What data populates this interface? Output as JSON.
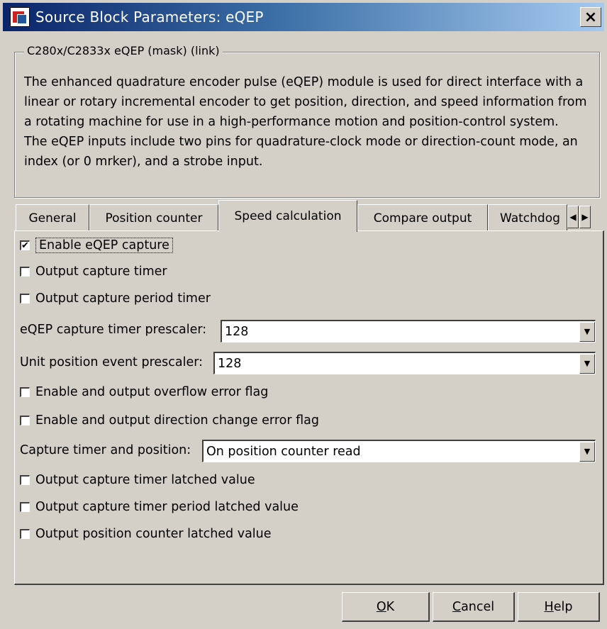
{
  "window": {
    "title": "Source Block Parameters: eQEP",
    "close_label": "×"
  },
  "group": {
    "legend": "C280x/C2833x eQEP (mask) (link)",
    "description": [
      "The enhanced quadrature encoder pulse (eQEP) module is used for direct interface with a linear or rotary incremental encoder to get position, direction, and speed information from a rotating machine for use in a high-performance motion and position-control system.",
      "The eQEP inputs include two pins for quadrature-clock mode or direction-count mode, an index (or 0 mrker), and a strobe input."
    ]
  },
  "tabs": [
    {
      "label": "General",
      "active": false
    },
    {
      "label": "Position counter",
      "active": false
    },
    {
      "label": "Speed calculation",
      "active": true
    },
    {
      "label": "Compare output",
      "active": false
    },
    {
      "label": "Watchdog",
      "active": false
    }
  ],
  "tab_scroll": {
    "left": "◀",
    "right": "▶"
  },
  "options": {
    "enable_capture": {
      "label": "Enable eQEP capture",
      "checked": true,
      "check_glyph": "✔"
    },
    "output_capture_timer": {
      "label": "Output capture timer",
      "checked": false
    },
    "output_capture_period_timer": {
      "label": "Output capture period timer",
      "checked": false
    },
    "capture_timer_prescaler": {
      "label": "eQEP capture timer prescaler:",
      "value": "128"
    },
    "unit_position_prescaler": {
      "label": "Unit position event prescaler:",
      "value": "128"
    },
    "overflow_error_flag": {
      "label": "Enable and output overflow error flag",
      "checked": false
    },
    "direction_change_error_flag": {
      "label": "Enable and output direction change error flag",
      "checked": false
    },
    "capture_timer_and_position": {
      "label": "Capture timer and position:",
      "value": "On position counter read"
    },
    "capture_timer_latched": {
      "label": "Output capture timer latched value",
      "checked": false
    },
    "capture_timer_period_latched": {
      "label": "Output capture timer period latched value",
      "checked": false
    },
    "position_counter_latched": {
      "label": "Output position counter latched value",
      "checked": false
    }
  },
  "dropdown_glyph": "▼",
  "buttons": {
    "ok": {
      "mnemonic": "O",
      "rest": "K"
    },
    "cancel": {
      "mnemonic": "C",
      "rest": "ancel"
    },
    "help": {
      "mnemonic": "H",
      "rest": "elp"
    }
  }
}
